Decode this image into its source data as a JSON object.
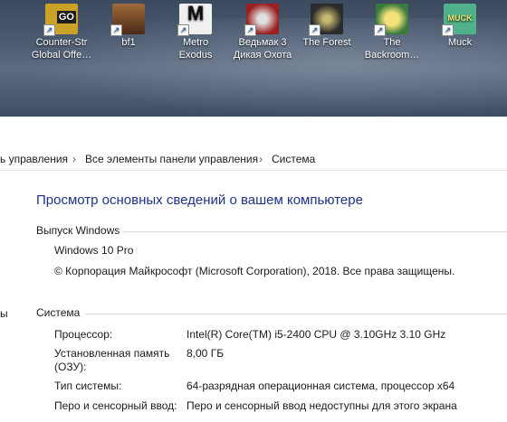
{
  "desktop_icons": [
    {
      "label": "Counter-Str\nGlobal Offe…",
      "icon": "csgo-icon",
      "bg": "#c9a227",
      "glyph": "GO"
    },
    {
      "label": "bf1",
      "icon": "bf1-icon",
      "bg": "#7a4a2c",
      "glyph": "1"
    },
    {
      "label": "Metro\nExodus",
      "icon": "metro-icon",
      "bg": "#f0f0f0",
      "glyph": "M"
    },
    {
      "label": "Ведьмак 3\nДикая Охота",
      "icon": "witcher-icon",
      "bg": "#9a1f1f",
      "glyph": "W"
    },
    {
      "label": "The Forest",
      "icon": "forest-icon",
      "bg": "#2b2b2b",
      "glyph": "F"
    },
    {
      "label": "The\nBackroom…",
      "icon": "backrooms-icon",
      "bg": "#d4b13a",
      "glyph": "B"
    },
    {
      "label": "Muck",
      "icon": "muck-icon",
      "bg": "#4fb28a",
      "glyph": "MUCK"
    }
  ],
  "breadcrumb": {
    "item1": "ь управления",
    "item2": "Все элементы панели управления",
    "item3": "Система",
    "separator": "›"
  },
  "page_title": "Просмотр основных сведений о вашем компьютере",
  "windows_edition": {
    "heading": "Выпуск Windows",
    "version": "Windows 10 Pro",
    "copyright": "© Корпорация Майкрософт (Microsoft Corporation), 2018. Все права защищены."
  },
  "left_cut_label": "ы",
  "system": {
    "heading": "Система",
    "rows": [
      {
        "label": "Процессор:",
        "value": "Intel(R) Core(TM) i5-2400 CPU @ 3.10GHz   3.10 GHz"
      },
      {
        "label": "Установленная память\n(ОЗУ):",
        "value": "8,00 ГБ"
      },
      {
        "label": "Тип системы:",
        "value": "64-разрядная операционная система, процессор x64"
      },
      {
        "label": "Перо и сенсорный ввод:",
        "value": "Перо и сенсорный ввод недоступны для этого экрана"
      }
    ]
  },
  "colors": {
    "title": "#1e3287"
  }
}
